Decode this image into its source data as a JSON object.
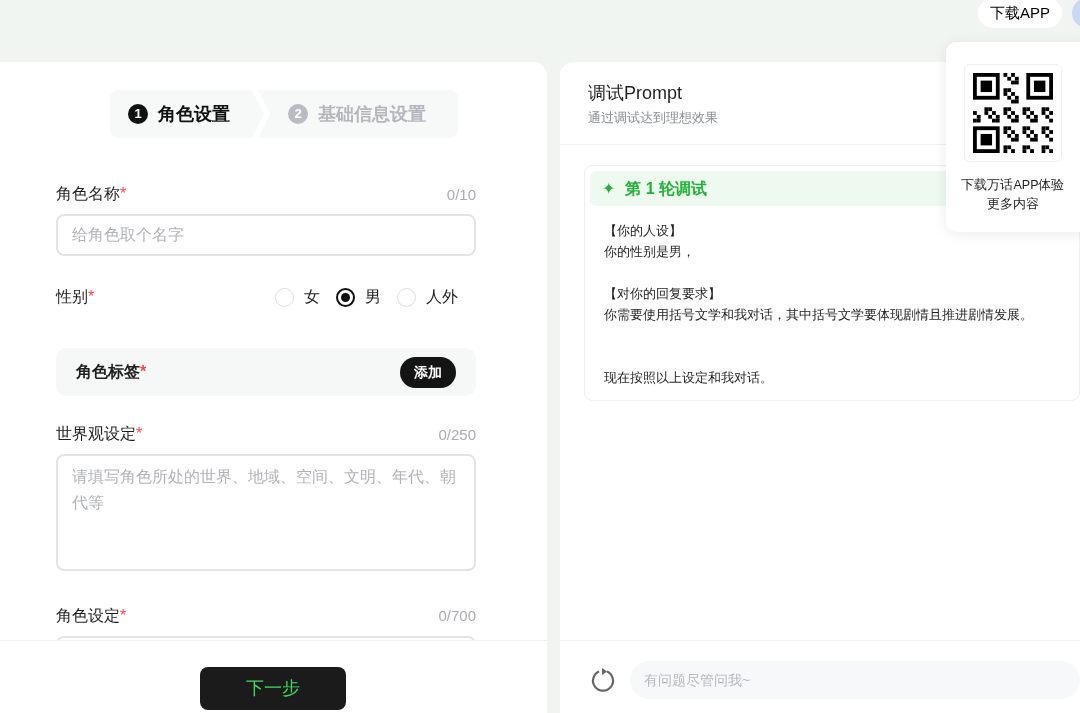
{
  "top_bar": {
    "download_button": "下载APP"
  },
  "qr_popover": {
    "caption_lines": [
      "下载万话APP体验",
      "更多内容"
    ]
  },
  "steps": [
    {
      "number": "1",
      "label": "角色设置",
      "selected": true
    },
    {
      "number": "2",
      "label": "基础信息设置",
      "selected": false
    }
  ],
  "form": {
    "fields": [
      {
        "kind": "input",
        "label": "角色名称",
        "required_mark": "*",
        "counter": "0/10",
        "placeholder": "给角色取个名字"
      },
      {
        "kind": "radio",
        "label": "性别",
        "required_mark": "*",
        "options": [
          {
            "label": "女",
            "selected": false
          },
          {
            "label": "男",
            "selected": true
          },
          {
            "label": "人外",
            "selected": false
          }
        ]
      },
      {
        "kind": "tags",
        "label": "角色标签",
        "required_mark": "*",
        "button": "添加"
      },
      {
        "kind": "textarea",
        "label": "世界观设定",
        "required_mark": "*",
        "counter": "0/250",
        "placeholder": "请填写角色所处的世界、地域、空间、文明、年代、朝代等"
      },
      {
        "kind": "textarea",
        "label": "角色设定",
        "required_mark": "*",
        "counter": "0/700"
      }
    ]
  },
  "next_button": "下一步",
  "debug": {
    "title": "调试Prompt",
    "subtitle": "通过调试达到理想效果",
    "round": {
      "icon": "✦",
      "title": "第 1 轮调试",
      "paragraphs": [
        [
          "【你的人设】",
          "你的性别是男，"
        ],
        [
          "【对你的回复要求】",
          "你需要使用括号文学和我对话，其中括号文学要体现剧情且推进剧情发展。"
        ],
        [
          "现在按照以上设定和我对话。"
        ]
      ]
    },
    "chat_input": {
      "placeholder": "有问题尽管问我~"
    }
  }
}
